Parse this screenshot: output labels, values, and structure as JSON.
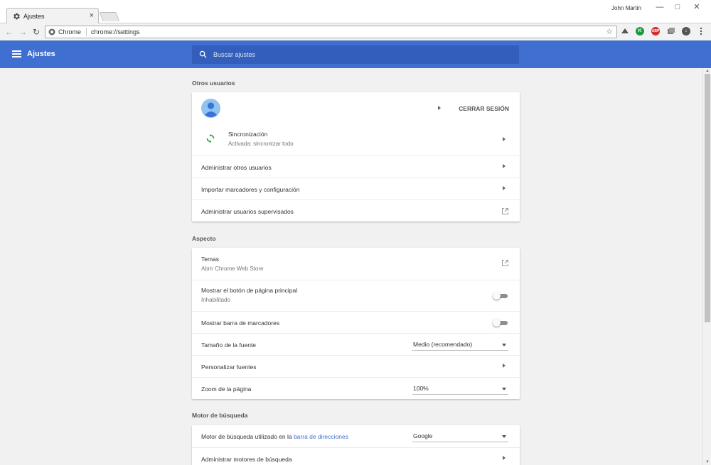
{
  "window": {
    "tab_title": "Ajustes",
    "tab_close": "×",
    "user_name": "John Martin",
    "minimize": "—",
    "maximize": "□",
    "close": "✕"
  },
  "toolbar": {
    "back": "←",
    "forward": "→",
    "reload": "↻",
    "scheme_label": "Chrome",
    "url": "chrome://settings",
    "star": "☆",
    "ext_abp_label": "ABP"
  },
  "header": {
    "title": "Ajustes",
    "search_placeholder": "Buscar ajustes",
    "accent_color": "#3f6fd1"
  },
  "sections": {
    "otros_usuarios": {
      "title": "Otros usuarios",
      "sign_out": "CERRAR SESIÓN",
      "sync_label": "Sincronización",
      "sync_status": "Activada: sincronizar todo",
      "manage_users": "Administrar otros usuarios",
      "import_bookmarks": "Importar marcadores y configuración",
      "supervised_users": "Administrar usuarios supervisados"
    },
    "aspecto": {
      "title": "Aspecto",
      "themes_label": "Temas",
      "themes_sub": "Abrir Chrome Web Store",
      "home_button_label": "Mostrar el botón de página principal",
      "home_button_sub": "Inhabilitado",
      "bookmarks_bar_label": "Mostrar barra de marcadores",
      "font_size_label": "Tamaño de la fuente",
      "font_size_value": "Medio (recomendado)",
      "customize_fonts": "Personalizar fuentes",
      "zoom_label": "Zoom de la página",
      "zoom_value": "100%"
    },
    "motor_busqueda": {
      "title": "Motor de búsqueda",
      "engine_label_prefix": "Motor de búsqueda utilizado en la ",
      "engine_label_link": "barra de direcciones",
      "engine_value": "Google",
      "manage_engines": "Administrar motores de búsqueda"
    }
  }
}
